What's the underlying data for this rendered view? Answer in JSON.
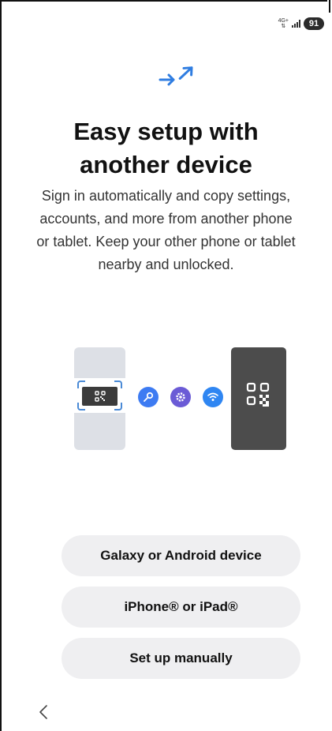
{
  "status_bar": {
    "network_type": "4G+",
    "battery_level": "91"
  },
  "page": {
    "title": "Easy setup with\nanother device",
    "description": "Sign in automatically and copy settings, accounts, and more from another phone or tablet. Keep your other phone or tablet nearby and unlocked."
  },
  "illustration": {
    "icons": [
      "qr-code-icon",
      "key-icon",
      "settings-icon",
      "wifi-icon"
    ],
    "accent_color": "#3b82f6"
  },
  "options": {
    "galaxy_label": "Galaxy or Android device",
    "iphone_label": "iPhone® or iPad®",
    "manual_label": "Set up manually"
  },
  "nav": {
    "back_icon": "chevron-left-icon"
  }
}
